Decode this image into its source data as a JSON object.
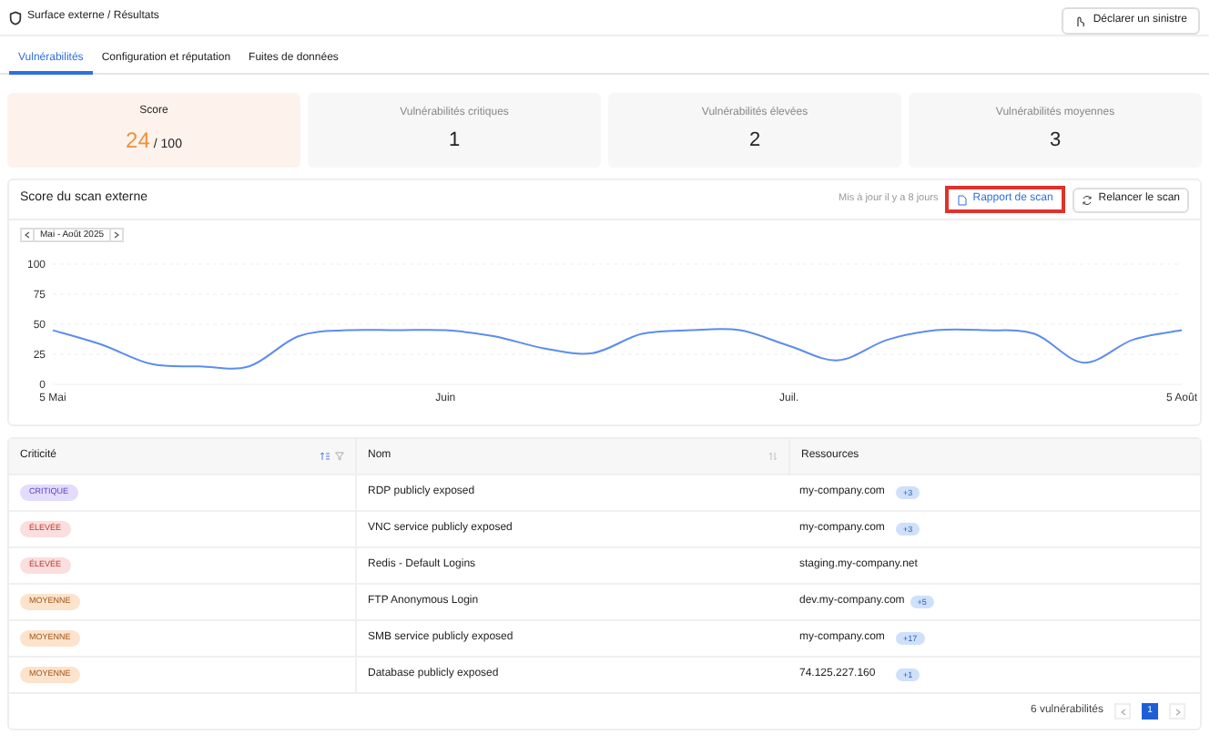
{
  "header": {
    "breadcrumb": "Surface externe / Résultats",
    "action": "Déclarer un sinistre"
  },
  "tabs": [
    {
      "label": "Vulnérabilités",
      "selected": true
    },
    {
      "label": "Configuration et réputation",
      "selected": false
    },
    {
      "label": "Fuites de données",
      "selected": false
    }
  ],
  "stats": [
    {
      "kind": "score",
      "label": "Score",
      "value": "24",
      "suffix": "/ 100"
    },
    {
      "kind": "count",
      "label": "Vulnérabilités critiques",
      "value": "1"
    },
    {
      "kind": "count",
      "label": "Vulnérabilités élevées",
      "value": "2"
    },
    {
      "kind": "count",
      "label": "Vulnérabilités moyennes",
      "value": "3"
    }
  ],
  "scan": {
    "title": "Score du scan externe",
    "updated": "Mis à jour il y a 8 jours",
    "report_button": "Rapport de scan",
    "rescan_button": "Relancer le scan",
    "period": "Mai - Août 2025",
    "chart_data": {
      "type": "line",
      "categories": [
        "5 Mai",
        null,
        null,
        null,
        null,
        null,
        null,
        null,
        "Juin",
        null,
        null,
        null,
        null,
        null,
        null,
        "Juil.",
        null,
        null,
        null,
        null,
        null,
        null,
        null,
        "5 Août"
      ],
      "series": [
        {
          "color": "#5b8def",
          "values": [
            45,
            33,
            17,
            15,
            15,
            40,
            45,
            45,
            45,
            40,
            30,
            26,
            42,
            45,
            45,
            32,
            20,
            37,
            45,
            45,
            42,
            18,
            37,
            45
          ]
        }
      ],
      "ylim": [
        0,
        100
      ],
      "grid": true,
      "yticks": [
        0,
        25,
        50,
        75,
        100
      ]
    }
  },
  "table": {
    "columns": [
      "Criticité",
      "Nom",
      "Ressources"
    ],
    "rows": [
      {
        "severity": "CRITIQUE",
        "kind": "critical",
        "name": "RDP publicly exposed",
        "resource": "my-company.com",
        "extra": "+3"
      },
      {
        "severity": "ÉLEVÉE",
        "kind": "high",
        "name": "VNC service publicly exposed",
        "resource": "my-company.com",
        "extra": "+3"
      },
      {
        "severity": "ÉLEVÉE",
        "kind": "high",
        "name": "Redis - Default Logins",
        "resource": "staging.my-company.net"
      },
      {
        "severity": "MOYENNE",
        "kind": "medium",
        "name": "FTP Anonymous Login",
        "resource": "dev.my-company.com",
        "extra": "+5"
      },
      {
        "severity": "MOYENNE",
        "kind": "medium",
        "name": "SMB service publicly exposed",
        "resource": "my-company.com",
        "extra": "+17"
      },
      {
        "severity": "MOYENNE",
        "kind": "medium",
        "name": "Database publicly exposed",
        "resource": "74.125.227.160",
        "extra": "+1"
      }
    ],
    "total": "6 vulnérabilités",
    "pages": [
      {
        "label": "1",
        "selected": true
      }
    ]
  }
}
